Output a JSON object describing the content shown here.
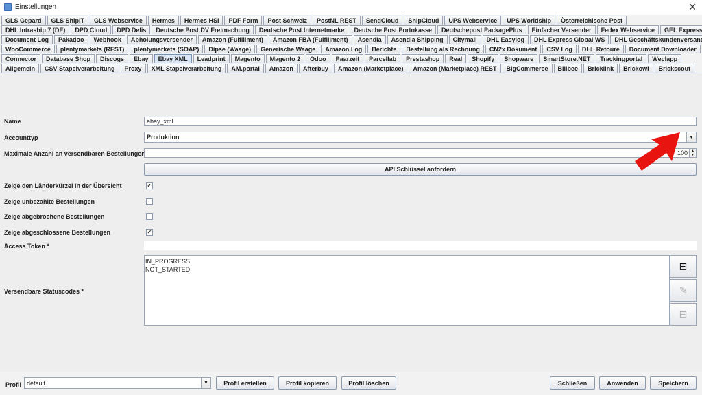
{
  "window": {
    "title": "Einstellungen",
    "close_glyph": "✕"
  },
  "tabs": {
    "row1": [
      "GLS Gepard",
      "GLS ShipIT",
      "GLS Webservice",
      "Hermes",
      "Hermes HSI",
      "PDF Form",
      "Post Schweiz",
      "PostNL REST",
      "SendCloud",
      "ShipCloud",
      "UPS Webservice",
      "UPS Worldship",
      "Österreichische Post"
    ],
    "row2": [
      "DHL Intraship 7 (DE)",
      "DPD Cloud",
      "DPD Delis",
      "Deutsche Post DV Freimachung",
      "Deutsche Post Internetmarke",
      "Deutsche Post Portokasse",
      "Deutschepost PackagePlus",
      "Einfacher Versender",
      "Fedex Webservice",
      "GEL Express"
    ],
    "row3": [
      "Document Log",
      "Pakadoo",
      "Webhook",
      "Abholungsversender",
      "Amazon (Fulfillment)",
      "Amazon FBA (Fulfillment)",
      "Asendia",
      "Asendia Shipping",
      "Citymail",
      "DHL Easylog",
      "DHL Express Global WS",
      "DHL Geschäftskundenversand"
    ],
    "row4": [
      "WooCommerce",
      "plentymarkets (REST)",
      "plentymarkets (SOAP)",
      "Dipse (Waage)",
      "Generische Waage",
      "Amazon Log",
      "Berichte",
      "Bestellung als Rechnung",
      "CN2x Dokument",
      "CSV Log",
      "DHL Retoure",
      "Document Downloader"
    ],
    "row5": [
      "Connector",
      "Database Shop",
      "Discogs",
      "Ebay",
      "Ebay XML",
      "Leadprint",
      "Magento",
      "Magento 2",
      "Odoo",
      "Paarzeit",
      "Parcellab",
      "Prestashop",
      "Real",
      "Shopify",
      "Shopware",
      "SmartStore.NET",
      "Trackingportal",
      "Weclapp"
    ],
    "row6": [
      "Allgemein",
      "CSV Stapelverarbeitung",
      "Proxy",
      "XML Stapelverarbeitung",
      "AM.portal",
      "Amazon",
      "Afterbuy",
      "Amazon (Marketplace)",
      "Amazon (Marketplace) REST",
      "BigCommerce",
      "Billbee",
      "Bricklink",
      "Brickowl",
      "Brickscout"
    ],
    "active": "Ebay XML"
  },
  "form": {
    "name_label": "Name",
    "name_value": "ebay_xml",
    "accounttyp_label": "Accounttyp",
    "accounttyp_value": "Produktion",
    "max_orders_label": "Maximale Anzahl an versendbaren Bestellungen",
    "max_orders_value": "100",
    "api_key_button": "API Schlüssel anfordern",
    "show_country_label": "Zeige den Länderkürzel in der Übersicht",
    "show_country_checked": true,
    "show_unpaid_label": "Zeige unbezahlte Bestellungen",
    "show_unpaid_checked": false,
    "show_cancelled_label": "Zeige abgebrochene Bestellungen",
    "show_cancelled_checked": false,
    "show_completed_label": "Zeige abgeschlossene Bestellungen",
    "show_completed_checked": true,
    "access_token_label": "Access Token *",
    "access_token_value": "",
    "status_codes_label": "Versendbare Statuscodes *",
    "status_codes": [
      "IN_PROGRESS",
      "NOT_STARTED"
    ],
    "check_glyph": "✔",
    "add_icon_glyph": "⊞",
    "edit_icon_glyph": "✎",
    "remove_icon_glyph": "⊟"
  },
  "bottom": {
    "profil_label": "Profil",
    "profil_value": "default",
    "create_button": "Profil erstellen",
    "copy_button": "Profil kopieren",
    "delete_button": "Profil löschen",
    "close_button": "Schließen",
    "apply_button": "Anwenden",
    "save_button": "Speichern"
  },
  "colors": {
    "arrow": "#e8140f",
    "active_tab": "#dbe7f6"
  }
}
